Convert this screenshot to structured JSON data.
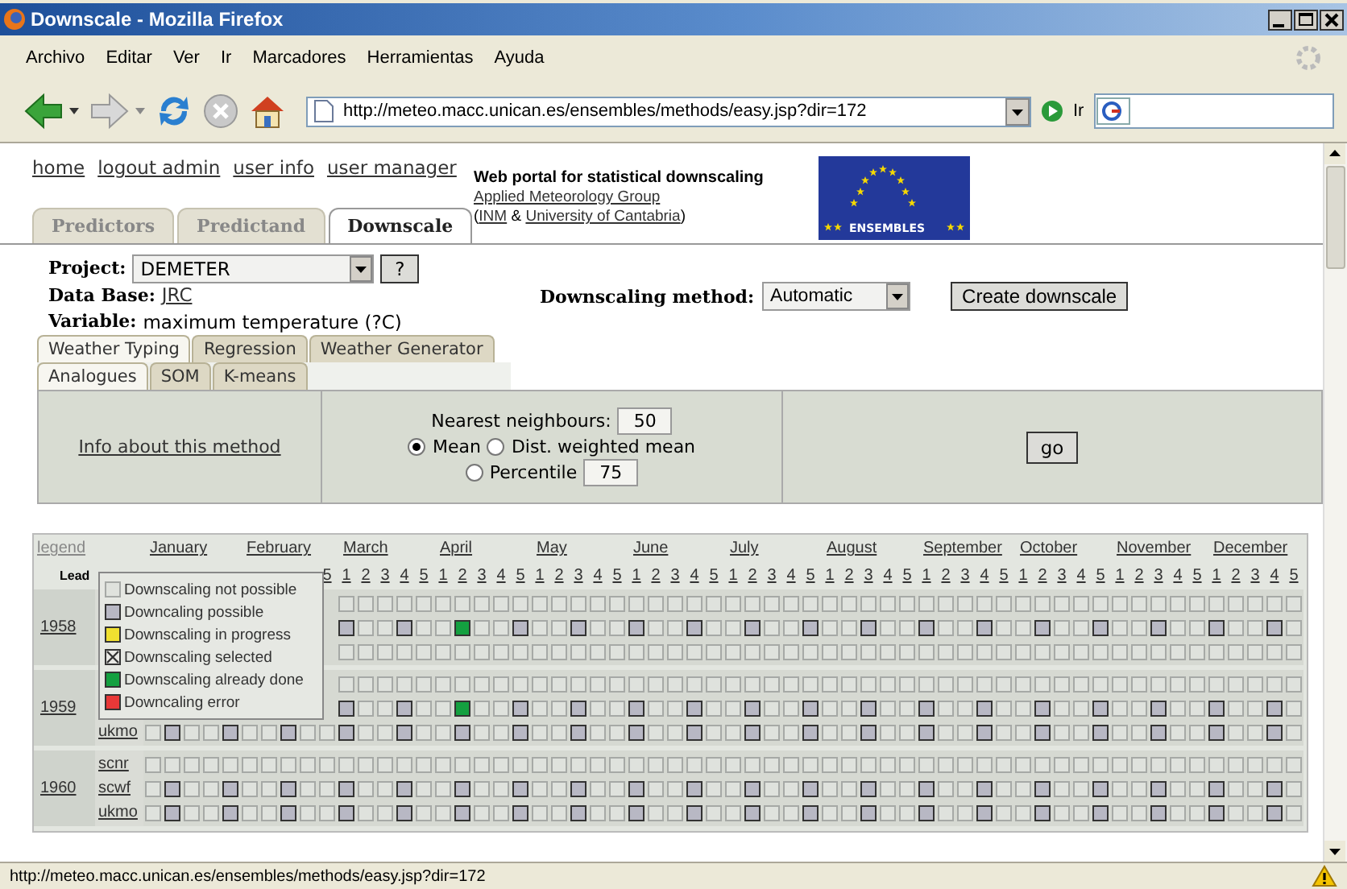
{
  "window": {
    "title": "Downscale - Mozilla Firefox"
  },
  "menu": [
    "Archivo",
    "Editar",
    "Ver",
    "Ir",
    "Marcadores",
    "Herramientas",
    "Ayuda"
  ],
  "toolbar": {
    "url": "http://meteo.macc.unican.es/ensembles/methods/easy.jsp?dir=172",
    "go_label": "Ir"
  },
  "header": {
    "links": [
      "home",
      "logout admin",
      "user info",
      "user manager"
    ],
    "portal_title": "Web portal for statistical downscaling",
    "group_link": "Applied Meteorology Group",
    "affiliation": [
      {
        "text": "(",
        "link": false
      },
      {
        "text": "INM",
        "link": true
      },
      {
        "text": " & ",
        "link": false
      },
      {
        "text": "University of Cantabria",
        "link": true
      },
      {
        "text": ")",
        "link": false
      }
    ],
    "logo_text": "ENSEMBLES"
  },
  "tabs": [
    {
      "label": "Predictors",
      "selected": false
    },
    {
      "label": "Predictand",
      "selected": false
    },
    {
      "label": "Downscale",
      "selected": true
    }
  ],
  "project": {
    "label": "Project:",
    "value": "DEMETER",
    "help": "?"
  },
  "database": {
    "label": "Data Base:",
    "value": "JRC"
  },
  "variable": {
    "label": "Variable:",
    "value": "maximum temperature (?C)"
  },
  "method": {
    "label": "Downscaling method:",
    "value": "Automatic",
    "button": "Create downscale"
  },
  "method_tabs": [
    [
      {
        "label": "Weather Typing",
        "selected": true
      },
      {
        "label": "Regression",
        "selected": false
      },
      {
        "label": "Weather Generator",
        "selected": false
      }
    ],
    [
      {
        "label": "Analogues",
        "selected": true
      },
      {
        "label": "SOM",
        "selected": false
      },
      {
        "label": "K-means",
        "selected": false
      }
    ]
  ],
  "panel": {
    "info_link": "Info about this method",
    "neighbours": {
      "label": "Nearest neighbours:",
      "value": "50"
    },
    "options": [
      {
        "label": "Mean",
        "selected": true
      },
      {
        "label": "Dist. weighted mean",
        "selected": false
      },
      {
        "label": "Percentile",
        "selected": false,
        "value": "75"
      }
    ],
    "go": "go"
  },
  "calendar": {
    "legend_link": "legend",
    "lead_label": "Lead",
    "months": [
      {
        "name": "January"
      },
      {
        "name": "February",
        "leads": [
          "5"
        ]
      },
      {
        "name": "March",
        "leads": [
          "1",
          "2",
          "3",
          "4",
          "5"
        ]
      },
      {
        "name": "April",
        "leads": [
          "1",
          "2",
          "3",
          "4",
          "5"
        ]
      },
      {
        "name": "May",
        "leads": [
          "1",
          "2",
          "3",
          "4",
          "5"
        ]
      },
      {
        "name": "June",
        "leads": [
          "1",
          "2",
          "3",
          "4",
          "5"
        ]
      },
      {
        "name": "July",
        "leads": [
          "1",
          "2",
          "3",
          "4",
          "5"
        ]
      },
      {
        "name": "August",
        "leads": [
          "1",
          "2",
          "3",
          "4",
          "5"
        ]
      },
      {
        "name": "September",
        "leads": [
          "1",
          "2",
          "3",
          "4",
          "5"
        ]
      },
      {
        "name": "October",
        "leads": [
          "1",
          "2",
          "3",
          "4",
          "5"
        ]
      },
      {
        "name": "November",
        "leads": [
          "1",
          "2",
          "3",
          "4",
          "5"
        ]
      },
      {
        "name": "December",
        "leads": [
          "1",
          "2",
          "3",
          "4",
          "5"
        ]
      }
    ],
    "years": [
      {
        "year": "1958",
        "rows": [
          {
            "cells": [
              {
                "kind": "na"
              },
              {
                "kind": "na"
              },
              {
                "kind": "na"
              },
              {
                "kind": "na"
              },
              {
                "kind": "na"
              },
              {
                "kind": "na"
              },
              {
                "kind": "na"
              },
              {
                "kind": "na"
              },
              {
                "kind": "na"
              },
              {
                "kind": "na"
              },
              {
                "kind": "na"
              },
              {
                "kind": "na"
              },
              {
                "kind": "na"
              },
              {
                "kind": "na"
              },
              {
                "kind": "na"
              },
              {
                "kind": "na"
              },
              {
                "kind": "na"
              },
              {
                "kind": "na"
              },
              {
                "kind": "na"
              },
              {
                "kind": "na"
              },
              {
                "kind": "na"
              },
              {
                "kind": "na"
              },
              {
                "kind": "na"
              },
              {
                "kind": "na"
              },
              {
                "kind": "na"
              },
              {
                "kind": "na"
              },
              {
                "kind": "na"
              },
              {
                "kind": "na"
              },
              {
                "kind": "na"
              },
              {
                "kind": "na"
              },
              {
                "kind": "na"
              },
              {
                "kind": "na"
              },
              {
                "kind": "na"
              },
              {
                "kind": "na"
              },
              {
                "kind": "na"
              },
              {
                "kind": "na"
              },
              {
                "kind": "na"
              },
              {
                "kind": "na"
              },
              {
                "kind": "na"
              },
              {
                "kind": "na"
              },
              {
                "kind": "na"
              },
              {
                "kind": "na"
              },
              {
                "kind": "na"
              },
              {
                "kind": "na"
              },
              {
                "kind": "na"
              },
              {
                "kind": "na"
              },
              {
                "kind": "na"
              },
              {
                "kind": "na"
              },
              {
                "kind": "na"
              },
              {
                "kind": "na"
              }
            ]
          },
          {
            "cells": [
              {
                "kind": "ok"
              },
              {
                "kind": "na"
              },
              {
                "kind": "na"
              },
              {
                "kind": "ok"
              },
              {
                "kind": "na"
              },
              {
                "kind": "na"
              },
              {
                "kind": "done"
              },
              {
                "kind": "na"
              },
              {
                "kind": "na"
              },
              {
                "kind": "ok"
              },
              {
                "kind": "na"
              },
              {
                "kind": "na"
              },
              {
                "kind": "ok"
              },
              {
                "kind": "na"
              },
              {
                "kind": "na"
              },
              {
                "kind": "ok"
              },
              {
                "kind": "na"
              },
              {
                "kind": "na"
              },
              {
                "kind": "ok"
              },
              {
                "kind": "na"
              },
              {
                "kind": "na"
              },
              {
                "kind": "ok"
              },
              {
                "kind": "na"
              },
              {
                "kind": "na"
              },
              {
                "kind": "ok"
              },
              {
                "kind": "na"
              },
              {
                "kind": "na"
              },
              {
                "kind": "ok"
              },
              {
                "kind": "na"
              },
              {
                "kind": "na"
              },
              {
                "kind": "ok"
              },
              {
                "kind": "na"
              },
              {
                "kind": "na"
              },
              {
                "kind": "ok"
              },
              {
                "kind": "na"
              },
              {
                "kind": "na"
              },
              {
                "kind": "ok"
              },
              {
                "kind": "na"
              },
              {
                "kind": "na"
              },
              {
                "kind": "ok"
              },
              {
                "kind": "na"
              },
              {
                "kind": "na"
              },
              {
                "kind": "ok"
              },
              {
                "kind": "na"
              },
              {
                "kind": "na"
              },
              {
                "kind": "ok"
              },
              {
                "kind": "na"
              },
              {
                "kind": "na"
              },
              {
                "kind": "ok"
              },
              {
                "kind": "na"
              }
            ]
          },
          {
            "cells": [
              {
                "kind": "na"
              },
              {
                "kind": "na"
              },
              {
                "kind": "na"
              },
              {
                "kind": "na"
              },
              {
                "kind": "na"
              },
              {
                "kind": "na"
              },
              {
                "kind": "na"
              },
              {
                "kind": "na"
              },
              {
                "kind": "na"
              },
              {
                "kind": "na"
              },
              {
                "kind": "na"
              },
              {
                "kind": "na"
              },
              {
                "kind": "na"
              },
              {
                "kind": "na"
              },
              {
                "kind": "na"
              },
              {
                "kind": "na"
              },
              {
                "kind": "na"
              },
              {
                "kind": "na"
              },
              {
                "kind": "na"
              },
              {
                "kind": "na"
              },
              {
                "kind": "na"
              },
              {
                "kind": "na"
              },
              {
                "kind": "na"
              },
              {
                "kind": "na"
              },
              {
                "kind": "na"
              },
              {
                "kind": "na"
              },
              {
                "kind": "na"
              },
              {
                "kind": "na"
              },
              {
                "kind": "na"
              },
              {
                "kind": "na"
              },
              {
                "kind": "na"
              },
              {
                "kind": "na"
              },
              {
                "kind": "na"
              },
              {
                "kind": "na"
              },
              {
                "kind": "na"
              },
              {
                "kind": "na"
              },
              {
                "kind": "na"
              },
              {
                "kind": "na"
              },
              {
                "kind": "na"
              },
              {
                "kind": "na"
              },
              {
                "kind": "na"
              },
              {
                "kind": "na"
              },
              {
                "kind": "na"
              },
              {
                "kind": "na"
              },
              {
                "kind": "na"
              },
              {
                "kind": "na"
              },
              {
                "kind": "na"
              },
              {
                "kind": "na"
              },
              {
                "kind": "na"
              },
              {
                "kind": "na"
              }
            ]
          }
        ]
      },
      {
        "year": "1959",
        "rows": [
          {
            "cells": [
              {
                "kind": "na"
              },
              {
                "kind": "na"
              },
              {
                "kind": "na"
              },
              {
                "kind": "na"
              },
              {
                "kind": "na"
              },
              {
                "kind": "na"
              },
              {
                "kind": "na"
              },
              {
                "kind": "na"
              },
              {
                "kind": "na"
              },
              {
                "kind": "na"
              },
              {
                "kind": "na"
              },
              {
                "kind": "na"
              },
              {
                "kind": "na"
              },
              {
                "kind": "na"
              },
              {
                "kind": "na"
              },
              {
                "kind": "na"
              },
              {
                "kind": "na"
              },
              {
                "kind": "na"
              },
              {
                "kind": "na"
              },
              {
                "kind": "na"
              },
              {
                "kind": "na"
              },
              {
                "kind": "na"
              },
              {
                "kind": "na"
              },
              {
                "kind": "na"
              },
              {
                "kind": "na"
              },
              {
                "kind": "na"
              },
              {
                "kind": "na"
              },
              {
                "kind": "na"
              },
              {
                "kind": "na"
              },
              {
                "kind": "na"
              },
              {
                "kind": "na"
              },
              {
                "kind": "na"
              },
              {
                "kind": "na"
              },
              {
                "kind": "na"
              },
              {
                "kind": "na"
              },
              {
                "kind": "na"
              },
              {
                "kind": "na"
              },
              {
                "kind": "na"
              },
              {
                "kind": "na"
              },
              {
                "kind": "na"
              },
              {
                "kind": "na"
              },
              {
                "kind": "na"
              },
              {
                "kind": "na"
              },
              {
                "kind": "na"
              },
              {
                "kind": "na"
              },
              {
                "kind": "na"
              },
              {
                "kind": "na"
              },
              {
                "kind": "na"
              },
              {
                "kind": "na"
              },
              {
                "kind": "na"
              }
            ]
          },
          {
            "cells": [
              {
                "kind": "ok"
              },
              {
                "kind": "na"
              },
              {
                "kind": "na"
              },
              {
                "kind": "ok"
              },
              {
                "kind": "na"
              },
              {
                "kind": "na"
              },
              {
                "kind": "done"
              },
              {
                "kind": "na"
              },
              {
                "kind": "na"
              },
              {
                "kind": "ok"
              },
              {
                "kind": "na"
              },
              {
                "kind": "na"
              },
              {
                "kind": "ok"
              },
              {
                "kind": "na"
              },
              {
                "kind": "na"
              },
              {
                "kind": "ok"
              },
              {
                "kind": "na"
              },
              {
                "kind": "na"
              },
              {
                "kind": "ok"
              },
              {
                "kind": "na"
              },
              {
                "kind": "na"
              },
              {
                "kind": "ok"
              },
              {
                "kind": "na"
              },
              {
                "kind": "na"
              },
              {
                "kind": "ok"
              },
              {
                "kind": "na"
              },
              {
                "kind": "na"
              },
              {
                "kind": "ok"
              },
              {
                "kind": "na"
              },
              {
                "kind": "na"
              },
              {
                "kind": "ok"
              },
              {
                "kind": "na"
              },
              {
                "kind": "na"
              },
              {
                "kind": "ok"
              },
              {
                "kind": "na"
              },
              {
                "kind": "na"
              },
              {
                "kind": "ok"
              },
              {
                "kind": "na"
              },
              {
                "kind": "na"
              },
              {
                "kind": "ok"
              },
              {
                "kind": "na"
              },
              {
                "kind": "na"
              },
              {
                "kind": "ok"
              },
              {
                "kind": "na"
              },
              {
                "kind": "na"
              },
              {
                "kind": "ok"
              },
              {
                "kind": "na"
              },
              {
                "kind": "na"
              },
              {
                "kind": "ok"
              },
              {
                "kind": "na"
              }
            ]
          },
          {
            "model": "ukmo",
            "cells": [
              {
                "kind": "na"
              },
              {
                "kind": "ok"
              },
              {
                "kind": "na"
              },
              {
                "kind": "na"
              },
              {
                "kind": "ok"
              },
              {
                "kind": "na"
              },
              {
                "kind": "na"
              },
              {
                "kind": "ok"
              },
              {
                "kind": "na"
              },
              {
                "kind": "na"
              },
              {
                "kind": "ok"
              },
              {
                "kind": "na"
              },
              {
                "kind": "na"
              },
              {
                "kind": "ok"
              },
              {
                "kind": "na"
              },
              {
                "kind": "na"
              },
              {
                "kind": "ok"
              },
              {
                "kind": "na"
              },
              {
                "kind": "na"
              },
              {
                "kind": "ok"
              },
              {
                "kind": "na"
              },
              {
                "kind": "na"
              },
              {
                "kind": "ok"
              },
              {
                "kind": "na"
              },
              {
                "kind": "na"
              },
              {
                "kind": "ok"
              },
              {
                "kind": "na"
              },
              {
                "kind": "na"
              },
              {
                "kind": "ok"
              },
              {
                "kind": "na"
              },
              {
                "kind": "na"
              },
              {
                "kind": "ok"
              },
              {
                "kind": "na"
              },
              {
                "kind": "na"
              },
              {
                "kind": "ok"
              },
              {
                "kind": "na"
              },
              {
                "kind": "na"
              },
              {
                "kind": "ok"
              },
              {
                "kind": "na"
              },
              {
                "kind": "na"
              },
              {
                "kind": "ok"
              },
              {
                "kind": "na"
              },
              {
                "kind": "na"
              },
              {
                "kind": "ok"
              },
              {
                "kind": "na"
              },
              {
                "kind": "na"
              },
              {
                "kind": "ok"
              },
              {
                "kind": "na"
              },
              {
                "kind": "na"
              },
              {
                "kind": "ok"
              },
              {
                "kind": "na"
              },
              {
                "kind": "na"
              },
              {
                "kind": "ok"
              },
              {
                "kind": "na"
              },
              {
                "kind": "na"
              },
              {
                "kind": "ok"
              },
              {
                "kind": "na"
              },
              {
                "kind": "na"
              },
              {
                "kind": "ok"
              },
              {
                "kind": "na"
              }
            ]
          }
        ]
      },
      {
        "year": "1960",
        "rows": [
          {
            "model": "scnr",
            "cells": [
              {
                "kind": "na"
              },
              {
                "kind": "na"
              },
              {
                "kind": "na"
              },
              {
                "kind": "na"
              },
              {
                "kind": "na"
              },
              {
                "kind": "na"
              },
              {
                "kind": "na"
              },
              {
                "kind": "na"
              },
              {
                "kind": "na"
              },
              {
                "kind": "na"
              },
              {
                "kind": "na"
              },
              {
                "kind": "na"
              },
              {
                "kind": "na"
              },
              {
                "kind": "na"
              },
              {
                "kind": "na"
              },
              {
                "kind": "na"
              },
              {
                "kind": "na"
              },
              {
                "kind": "na"
              },
              {
                "kind": "na"
              },
              {
                "kind": "na"
              },
              {
                "kind": "na"
              },
              {
                "kind": "na"
              },
              {
                "kind": "na"
              },
              {
                "kind": "na"
              },
              {
                "kind": "na"
              },
              {
                "kind": "na"
              },
              {
                "kind": "na"
              },
              {
                "kind": "na"
              },
              {
                "kind": "na"
              },
              {
                "kind": "na"
              },
              {
                "kind": "na"
              },
              {
                "kind": "na"
              },
              {
                "kind": "na"
              },
              {
                "kind": "na"
              },
              {
                "kind": "na"
              },
              {
                "kind": "na"
              },
              {
                "kind": "na"
              },
              {
                "kind": "na"
              },
              {
                "kind": "na"
              },
              {
                "kind": "na"
              },
              {
                "kind": "na"
              },
              {
                "kind": "na"
              },
              {
                "kind": "na"
              },
              {
                "kind": "na"
              },
              {
                "kind": "na"
              },
              {
                "kind": "na"
              },
              {
                "kind": "na"
              },
              {
                "kind": "na"
              },
              {
                "kind": "na"
              },
              {
                "kind": "na"
              },
              {
                "kind": "na"
              },
              {
                "kind": "na"
              },
              {
                "kind": "na"
              },
              {
                "kind": "na"
              },
              {
                "kind": "na"
              },
              {
                "kind": "na"
              },
              {
                "kind": "na"
              },
              {
                "kind": "na"
              },
              {
                "kind": "na"
              },
              {
                "kind": "na"
              }
            ]
          },
          {
            "model": "scwf",
            "cells": [
              {
                "kind": "na"
              },
              {
                "kind": "ok"
              },
              {
                "kind": "na"
              },
              {
                "kind": "na"
              },
              {
                "kind": "ok"
              },
              {
                "kind": "na"
              },
              {
                "kind": "na"
              },
              {
                "kind": "ok"
              },
              {
                "kind": "na"
              },
              {
                "kind": "na"
              },
              {
                "kind": "ok"
              },
              {
                "kind": "na"
              },
              {
                "kind": "na"
              },
              {
                "kind": "ok"
              },
              {
                "kind": "na"
              },
              {
                "kind": "na"
              },
              {
                "kind": "ok"
              },
              {
                "kind": "na"
              },
              {
                "kind": "na"
              },
              {
                "kind": "ok"
              },
              {
                "kind": "na"
              },
              {
                "kind": "na"
              },
              {
                "kind": "ok"
              },
              {
                "kind": "na"
              },
              {
                "kind": "na"
              },
              {
                "kind": "ok"
              },
              {
                "kind": "na"
              },
              {
                "kind": "na"
              },
              {
                "kind": "ok"
              },
              {
                "kind": "na"
              },
              {
                "kind": "na"
              },
              {
                "kind": "ok"
              },
              {
                "kind": "na"
              },
              {
                "kind": "na"
              },
              {
                "kind": "ok"
              },
              {
                "kind": "na"
              },
              {
                "kind": "na"
              },
              {
                "kind": "ok"
              },
              {
                "kind": "na"
              },
              {
                "kind": "na"
              },
              {
                "kind": "ok"
              },
              {
                "kind": "na"
              },
              {
                "kind": "na"
              },
              {
                "kind": "ok"
              },
              {
                "kind": "na"
              },
              {
                "kind": "na"
              },
              {
                "kind": "ok"
              },
              {
                "kind": "na"
              },
              {
                "kind": "na"
              },
              {
                "kind": "ok"
              },
              {
                "kind": "na"
              },
              {
                "kind": "na"
              },
              {
                "kind": "ok"
              },
              {
                "kind": "na"
              },
              {
                "kind": "na"
              },
              {
                "kind": "ok"
              },
              {
                "kind": "na"
              },
              {
                "kind": "na"
              },
              {
                "kind": "ok"
              },
              {
                "kind": "na"
              }
            ]
          },
          {
            "model": "ukmo",
            "cells": [
              {
                "kind": "na"
              },
              {
                "kind": "ok"
              },
              {
                "kind": "na"
              },
              {
                "kind": "na"
              },
              {
                "kind": "ok"
              },
              {
                "kind": "na"
              },
              {
                "kind": "na"
              },
              {
                "kind": "ok"
              },
              {
                "kind": "na"
              },
              {
                "kind": "na"
              },
              {
                "kind": "ok"
              },
              {
                "kind": "na"
              },
              {
                "kind": "na"
              },
              {
                "kind": "ok"
              },
              {
                "kind": "na"
              },
              {
                "kind": "na"
              },
              {
                "kind": "ok"
              },
              {
                "kind": "na"
              },
              {
                "kind": "na"
              },
              {
                "kind": "ok"
              },
              {
                "kind": "na"
              },
              {
                "kind": "na"
              },
              {
                "kind": "ok"
              },
              {
                "kind": "na"
              },
              {
                "kind": "na"
              },
              {
                "kind": "ok"
              },
              {
                "kind": "na"
              },
              {
                "kind": "na"
              },
              {
                "kind": "ok"
              },
              {
                "kind": "na"
              },
              {
                "kind": "na"
              },
              {
                "kind": "ok"
              },
              {
                "kind": "na"
              },
              {
                "kind": "na"
              },
              {
                "kind": "ok"
              },
              {
                "kind": "na"
              },
              {
                "kind": "na"
              },
              {
                "kind": "ok"
              },
              {
                "kind": "na"
              },
              {
                "kind": "na"
              },
              {
                "kind": "ok"
              },
              {
                "kind": "na"
              },
              {
                "kind": "na"
              },
              {
                "kind": "ok"
              },
              {
                "kind": "na"
              },
              {
                "kind": "na"
              },
              {
                "kind": "ok"
              },
              {
                "kind": "na"
              },
              {
                "kind": "na"
              },
              {
                "kind": "ok"
              },
              {
                "kind": "na"
              },
              {
                "kind": "na"
              },
              {
                "kind": "ok"
              },
              {
                "kind": "na"
              },
              {
                "kind": "na"
              },
              {
                "kind": "ok"
              },
              {
                "kind": "na"
              },
              {
                "kind": "na"
              },
              {
                "kind": "ok"
              },
              {
                "kind": "na"
              }
            ]
          }
        ]
      }
    ],
    "legend": [
      {
        "label": "Downscaling not possible",
        "kind": "na"
      },
      {
        "label": "Downcaling possible",
        "kind": "ok"
      },
      {
        "label": "Downscaling in progress",
        "kind": "busy"
      },
      {
        "label": "Downscaling selected",
        "kind": "sel"
      },
      {
        "label": "Downscaling already done",
        "kind": "done"
      },
      {
        "label": "Downcaling error",
        "kind": "err"
      }
    ]
  },
  "status_bar": {
    "text": "http://meteo.macc.unican.es/ensembles/methods/easy.jsp?dir=172"
  }
}
